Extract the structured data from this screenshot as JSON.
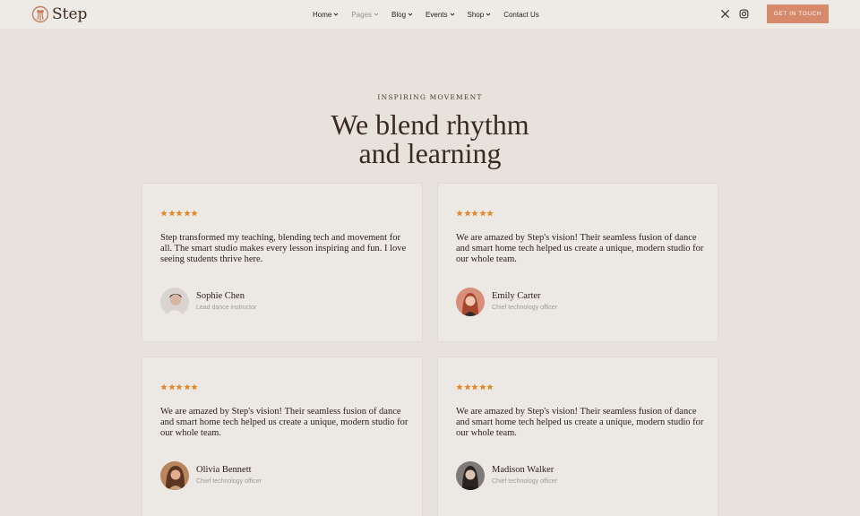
{
  "brand": {
    "name": "Step"
  },
  "nav": [
    {
      "label": "Home",
      "dropdown": true,
      "active": true
    },
    {
      "label": "Pages",
      "dropdown": true,
      "active": false
    },
    {
      "label": "Blog",
      "dropdown": true,
      "active": true
    },
    {
      "label": "Events",
      "dropdown": true,
      "active": true
    },
    {
      "label": "Shop",
      "dropdown": true,
      "active": true
    },
    {
      "label": "Contact Us",
      "dropdown": false,
      "active": true
    }
  ],
  "social": [
    "x-icon",
    "instagram-icon"
  ],
  "cta": {
    "label": "GET IN TOUCH"
  },
  "section": {
    "eyebrow": "INSPIRING MOVEMENT",
    "headline_line1": "We blend rhythm",
    "headline_line2": "and learning"
  },
  "testimonials": [
    {
      "rating": 5,
      "quote": "Step transformed my teaching, blending tech and movement for all. The smart studio makes every lesson inspiring and fun. I love seeing students thrive here.",
      "name": "Sophie Chen",
      "role": "Lead dance instructor"
    },
    {
      "rating": 5,
      "quote": "We are amazed by Step's vision! Their seamless fusion of dance and smart home tech helped us create a unique, modern studio for our whole team.",
      "name": "Emily Carter",
      "role": "Chief technology officer"
    },
    {
      "rating": 5,
      "quote": "We are amazed by Step's vision! Their seamless fusion of dance and smart home tech helped us create a unique, modern studio for our whole team.",
      "name": "Olivia Bennett",
      "role": "Chief technology officer"
    },
    {
      "rating": 5,
      "quote": "We are amazed by Step's vision! Their seamless fusion of dance and smart home tech helped us create a unique, modern studio for our whole team.",
      "name": "Madison Walker",
      "role": "Chief technology officer"
    }
  ],
  "colors": {
    "background": "#e7e2dc",
    "header": "#eeebe7",
    "card": "#ece9e4",
    "accent": "#d7896b",
    "star": "#e2882a",
    "text": "#3b2a1e"
  }
}
